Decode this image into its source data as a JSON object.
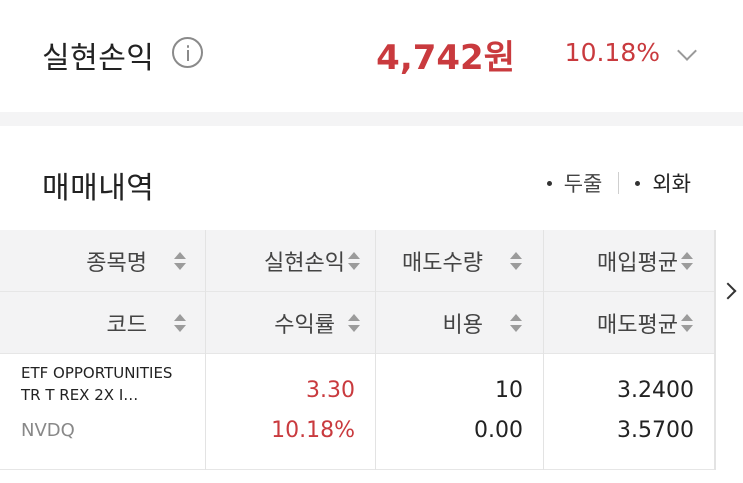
{
  "summary": {
    "label": "실현손익",
    "amount": "4,742원",
    "rate": "10.18%"
  },
  "trade_history": {
    "title": "매매내역",
    "unit_options": [
      "두줄",
      "외화"
    ]
  },
  "table": {
    "header_row1": [
      "종목명",
      "실현손익",
      "매도수량",
      "매입평균"
    ],
    "header_row2": [
      "코드",
      "수익률",
      "비용",
      "매도평균"
    ],
    "rows": [
      {
        "name": "ETF OPPORTUNITIES TR T REX 2X I…",
        "code": "NVDQ",
        "realized_pl": "3.30",
        "return_rate": "10.18%",
        "sell_qty": "10",
        "cost": "0.00",
        "avg_buy": "3.2400",
        "avg_sell": "3.5700"
      }
    ]
  },
  "colors": {
    "accent_red": "#c93a3e",
    "header_bg": "#f3f3f4"
  },
  "icons": [
    "info-icon",
    "chevron-down-icon",
    "sort-icon",
    "chevron-right-icon"
  ]
}
